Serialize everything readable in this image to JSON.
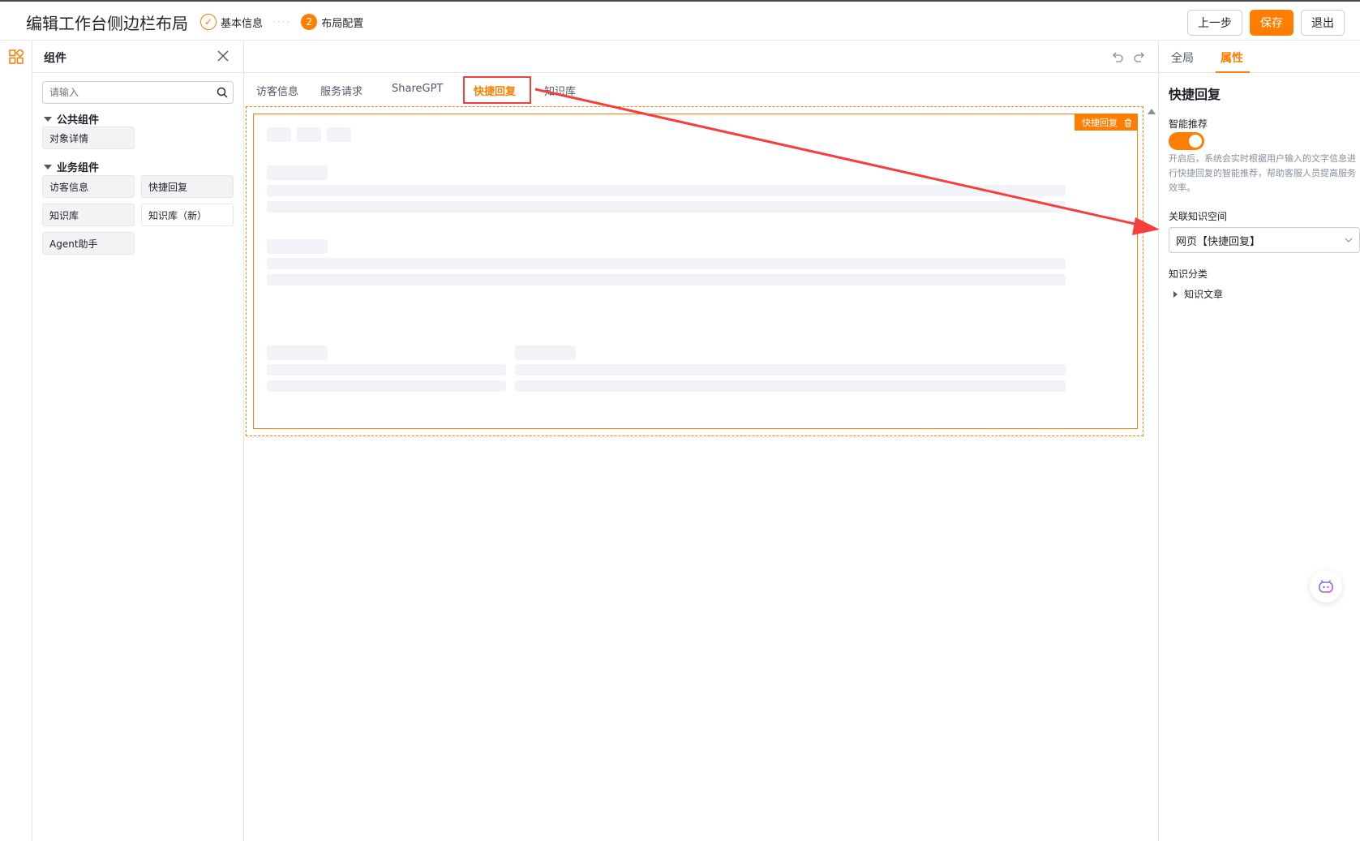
{
  "header": {
    "title": "编辑工作台侧边栏布局",
    "steps": [
      {
        "index": "✓",
        "label": "基本信息"
      },
      {
        "index": "2",
        "label": "布局配置"
      }
    ],
    "buttons": {
      "prev": "上一步",
      "save": "保存",
      "exit": "退出"
    }
  },
  "component_panel": {
    "title": "组件",
    "search_placeholder": "请输入",
    "groups": [
      {
        "title": "公共组件",
        "items": [
          "对象详情"
        ]
      },
      {
        "title": "业务组件",
        "items": [
          "访客信息",
          "快捷回复",
          "知识库",
          "知识库（新）",
          "Agent助手"
        ]
      }
    ]
  },
  "canvas": {
    "tabs": [
      "访客信息",
      "服务请求",
      "ShareGPT",
      "快捷回复",
      "知识库"
    ],
    "active_tab": "快捷回复",
    "selected_badge": "快捷回复"
  },
  "properties": {
    "tabs": [
      "全局",
      "属性"
    ],
    "active_tab": "属性",
    "section_title": "快捷回复",
    "smart_recommend_label": "智能推荐",
    "smart_recommend_on": true,
    "smart_recommend_desc": "开启后，系统会实时根据用户输入的文字信息进行快捷回复的智能推荐，帮助客服人员提高服务效率。",
    "knowledge_space_label": "关联知识空间",
    "knowledge_space_value": "网页【快捷回复】",
    "knowledge_category_label": "知识分类",
    "knowledge_tree_item": "知识文章"
  },
  "colors": {
    "accent": "#ff7d00",
    "annotation": "#f53f3f"
  }
}
